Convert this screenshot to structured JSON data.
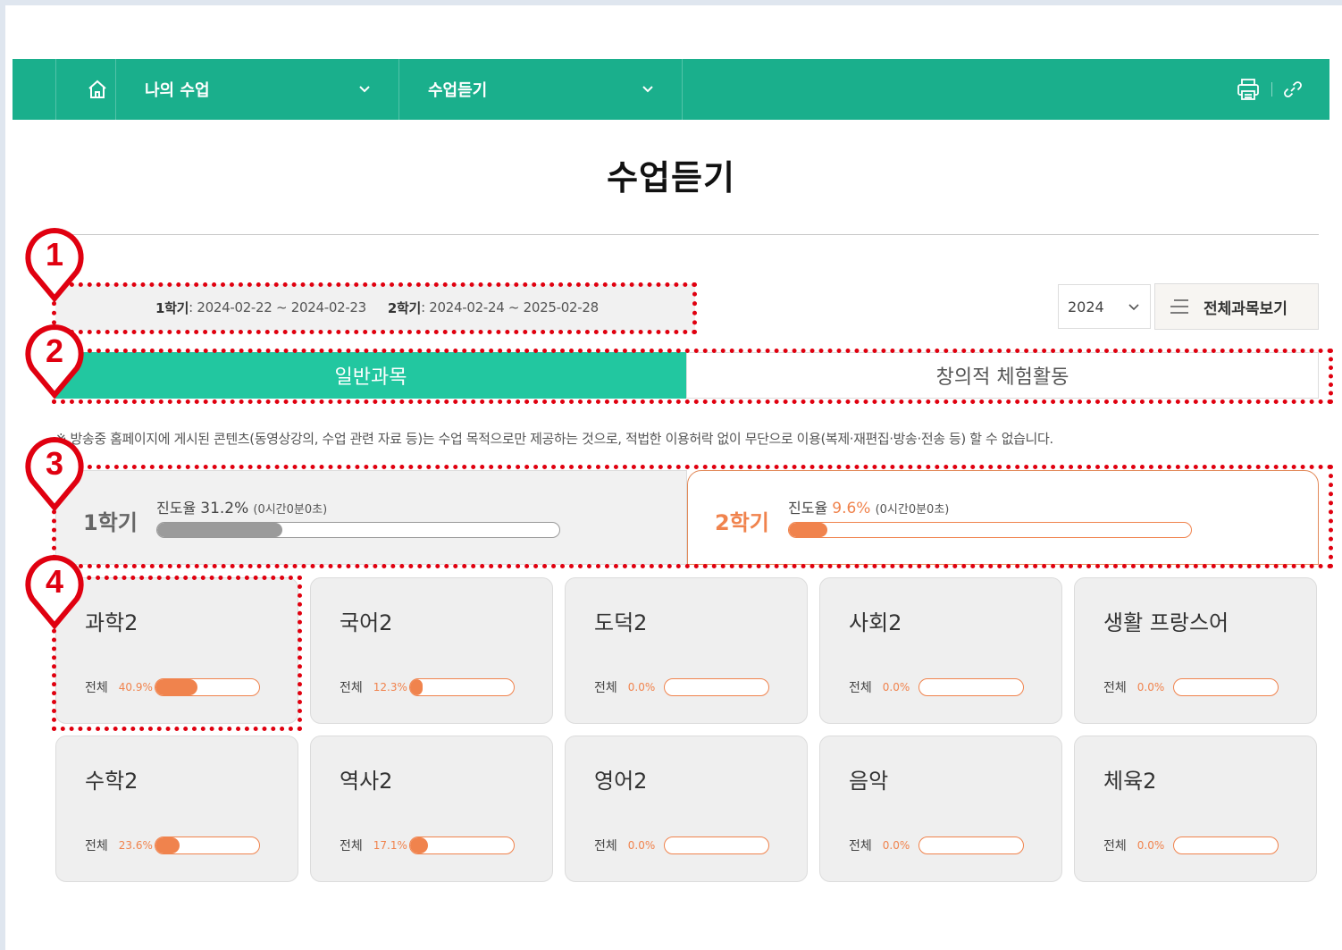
{
  "nav": {
    "home_icon": "home-icon",
    "dropdown1": "나의 수업",
    "dropdown2": "수업듣기",
    "print_icon": "print-icon",
    "link_icon": "link-icon",
    "accent": "#1aaf8c"
  },
  "page": {
    "title": "수업듣기"
  },
  "semesters": {
    "s1_label": "1학기",
    "s1_range": " : 2024-02-22 ~ 2024-02-23",
    "s2_label": "2학기",
    "s2_range": " : 2024-02-24 ~ 2025-02-28"
  },
  "year_select": {
    "value": "2024"
  },
  "all_subjects_button": "전체과목보기",
  "tabs": [
    {
      "label": "일반과목",
      "active": true
    },
    {
      "label": "창의적 체험활동",
      "active": false
    }
  ],
  "notice": "※ 방송중 홈페이지에 게시된 콘텐츠(동영상강의, 수업 관련 자료 등)는 수업 목적으로만 제공하는 것으로, 적법한 이용허락 없이 무단으로 이용(복제·재편집·방송·전송 등) 할 수 없습니다.",
  "progress": [
    {
      "semester": "1학기",
      "label": "진도율",
      "percent_text": "31.2%",
      "time": "(0시간0분0초)",
      "fraction": 0.312
    },
    {
      "semester": "2학기",
      "label": "진도율",
      "percent_text": "9.6%",
      "time": "(0시간0분0초)",
      "fraction": 0.096
    }
  ],
  "subjects": [
    {
      "name": "과학2",
      "label": "전체",
      "percent_text": "40.9%",
      "fraction": 0.409
    },
    {
      "name": "국어2",
      "label": "전체",
      "percent_text": "12.3%",
      "fraction": 0.123
    },
    {
      "name": "도덕2",
      "label": "전체",
      "percent_text": "0.0%",
      "fraction": 0.0
    },
    {
      "name": "사회2",
      "label": "전체",
      "percent_text": "0.0%",
      "fraction": 0.0
    },
    {
      "name": "생활 프랑스어",
      "label": "전체",
      "percent_text": "0.0%",
      "fraction": 0.0
    },
    {
      "name": "수학2",
      "label": "전체",
      "percent_text": "23.6%",
      "fraction": 0.236
    },
    {
      "name": "역사2",
      "label": "전체",
      "percent_text": "17.1%",
      "fraction": 0.171
    },
    {
      "name": "영어2",
      "label": "전체",
      "percent_text": "0.0%",
      "fraction": 0.0
    },
    {
      "name": "음악",
      "label": "전체",
      "percent_text": "0.0%",
      "fraction": 0.0
    },
    {
      "name": "체육2",
      "label": "전체",
      "percent_text": "0.0%",
      "fraction": 0.0
    }
  ],
  "annotations": [
    "1",
    "2",
    "3",
    "4"
  ],
  "colors": {
    "orange": "#f0834d",
    "tab_active": "#22c7a0",
    "annotation_red": "#e00010"
  }
}
